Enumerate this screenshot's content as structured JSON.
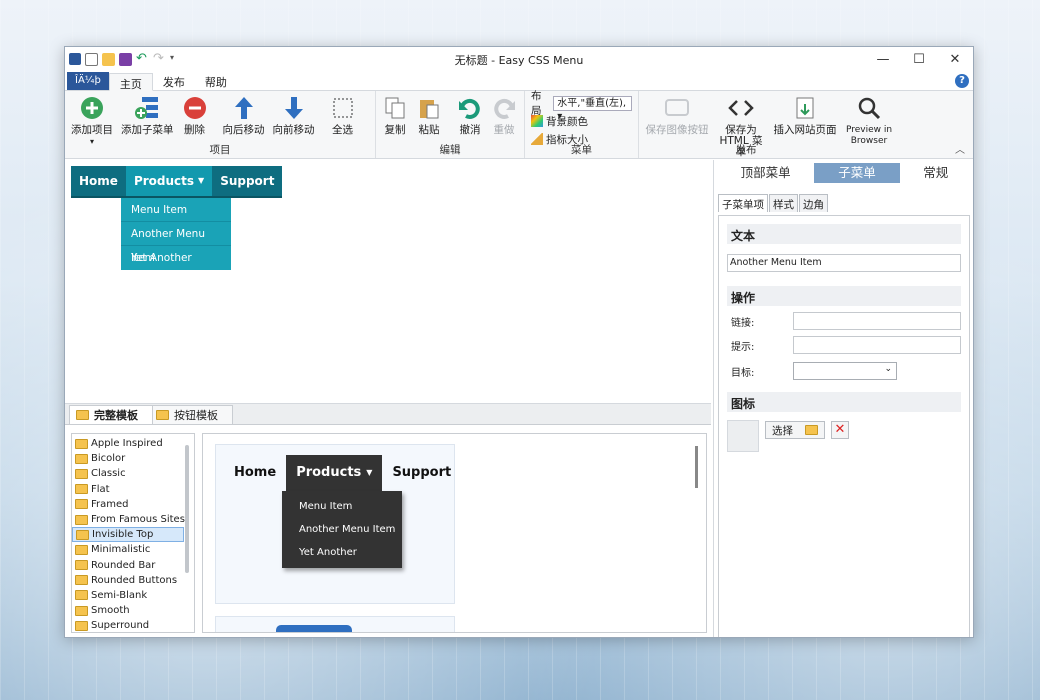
{
  "window": {
    "title": "无标题 - Easy CSS Menu"
  },
  "ribbon": {
    "file_tab": "ÎÄ¼þ",
    "tabs": [
      "主页",
      "发布",
      "帮助"
    ],
    "help": "?",
    "groups": {
      "items": {
        "label": "项目",
        "add_item": "添加项目",
        "add_subitem": "添加子菜单",
        "delete": "删除",
        "move_back": "向后移动",
        "move_forward": "向前移动",
        "select_all": "全选"
      },
      "edit": {
        "label": "编辑",
        "copy": "复制",
        "paste": "粘贴",
        "undo": "撤消",
        "redo": "重做"
      },
      "menu": {
        "label": "菜单",
        "layout_label": "布局",
        "layout_value": "水平,\"垂直(左),",
        "bg_color": "背景颜色",
        "pointer_size": "指标大小"
      },
      "publish": {
        "label": "发布",
        "save_image": "保存图像按钮",
        "save_html": "保存为\nHTML 菜单",
        "insert_site": "插入网站页面",
        "preview": "Preview in\nBrowser"
      }
    }
  },
  "canvas_menu": {
    "items": [
      "Home",
      "Products",
      "Support"
    ],
    "submenu": [
      "Menu Item",
      "Another Menu Item",
      "Yet Another"
    ]
  },
  "bottom": {
    "tabs": [
      "完整模板",
      "按钮模板"
    ],
    "templates": [
      "Apple Inspired",
      "Bicolor",
      "Classic",
      "Flat",
      "Framed",
      "From Famous Sites",
      "Invisible Top",
      "Minimalistic",
      "Rounded Bar",
      "Rounded Buttons",
      "Semi-Blank",
      "Smooth",
      "Superround"
    ],
    "selected_template": "Invisible Top",
    "preview_menu": {
      "items": [
        "Home",
        "Products",
        "Support"
      ],
      "submenu": [
        "Menu Item",
        "Another Menu Item",
        "Yet Another"
      ]
    }
  },
  "properties": {
    "tabs": [
      "顶部菜单",
      "子菜单",
      "常规"
    ],
    "active_tab": "子菜单",
    "subtabs": [
      "子菜单项",
      "样式",
      "边角"
    ],
    "text_section": "文本",
    "text_value": "Another Menu Item",
    "action_section": "操作",
    "link_label": "链接:",
    "tip_label": "提示:",
    "target_label": "目标:",
    "icon_section": "图标",
    "choose_label": "选择"
  },
  "colors": {
    "menu_bg": "#0e6d80",
    "menu_active": "#1299ae",
    "sub_bg": "#1aa3b7",
    "preview_dark": "#333333",
    "accent": "#2b579a"
  }
}
